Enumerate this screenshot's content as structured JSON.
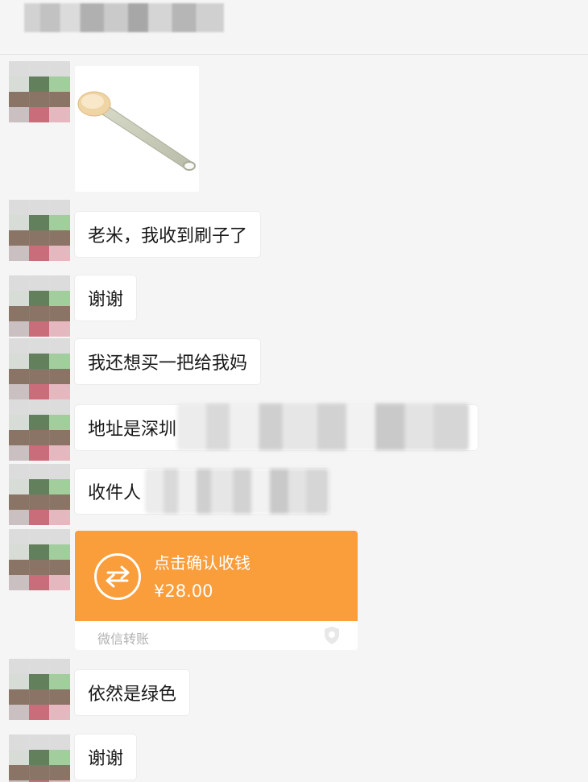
{
  "messages": {
    "m1": "老米，我收到刷子了",
    "m2": "谢谢",
    "m3": "我还想买一把给我妈",
    "m4_prefix": "地址是深圳",
    "m4_suffix": "，",
    "m5_prefix": "收件人",
    "m6": "依然是绿色",
    "m7": "谢谢"
  },
  "transfer": {
    "title": "点击确认收钱",
    "amount": "¥28.00",
    "footer": "微信转账",
    "color": "#fa9d3b"
  },
  "icons": {
    "transfer": "transfer-arrows-icon",
    "shield": "shield-icon",
    "avatar": "avatar"
  }
}
